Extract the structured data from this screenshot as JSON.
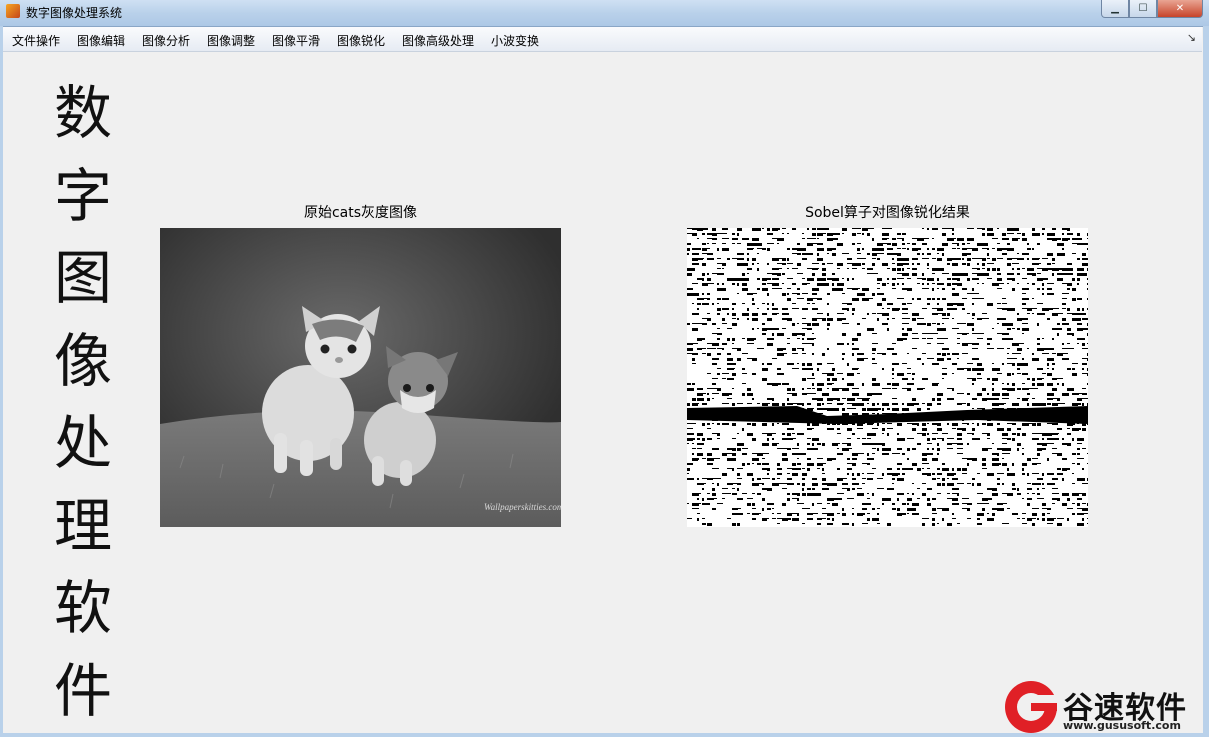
{
  "window": {
    "title": "数字图像处理系统"
  },
  "menu": {
    "items": [
      "文件操作",
      "图像编辑",
      "图像分析",
      "图像调整",
      "图像平滑",
      "图像锐化",
      "图像高级处理",
      "小波变换"
    ],
    "corner_glyph": "↘"
  },
  "vertical_title": "数字图像处理软件",
  "axes": {
    "left_title": "原始cats灰度图像",
    "right_title": "Sobel算子对图像锐化结果",
    "watermark": "Wallpaperskitties.com"
  },
  "watermark_logo": {
    "name": "谷速软件",
    "url": "www.gususoft.com"
  }
}
